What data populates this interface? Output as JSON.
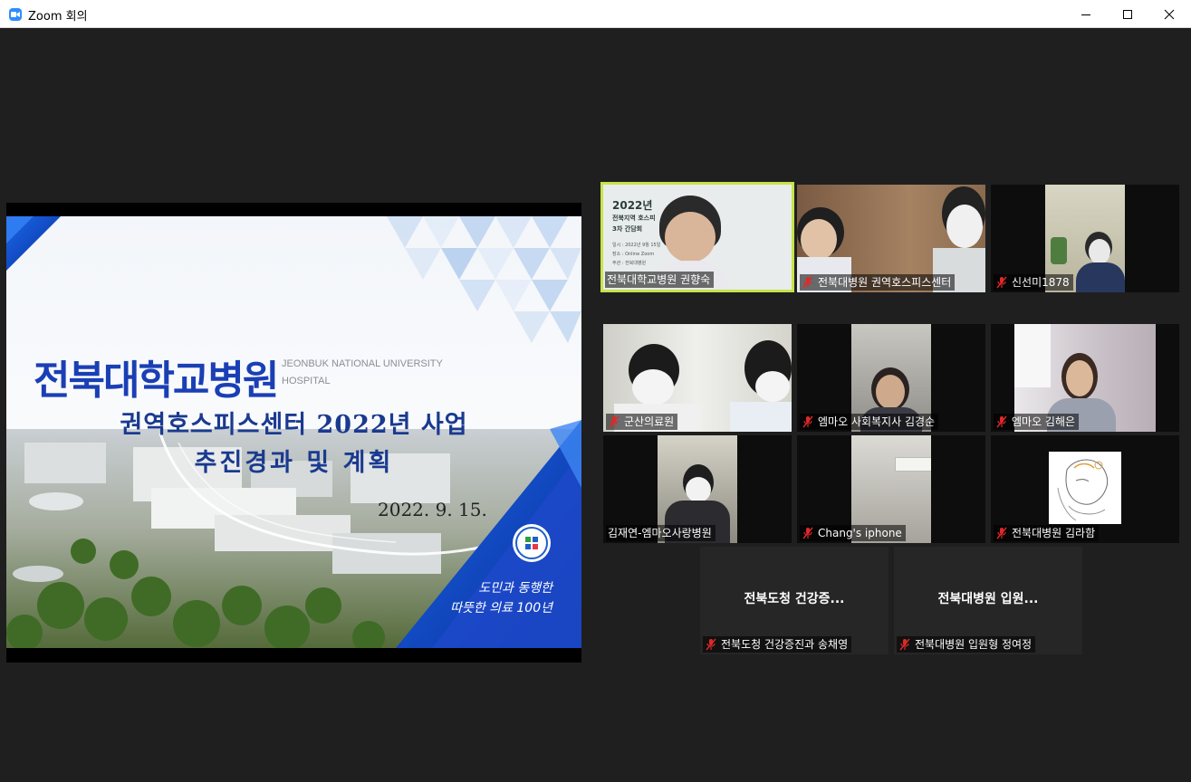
{
  "window": {
    "title": "Zoom 회의"
  },
  "colors": {
    "active_speaker": "#c7e34a",
    "background": "#1f1f1f",
    "mute": "#e02828"
  },
  "share": {
    "hospital_name_ko": "전북대학교병원",
    "hospital_name_en_1": "JEONBUK NATIONAL UNIVERSITY",
    "hospital_name_en_2": "HOSPITAL",
    "title_line1": "권역호스피스센터 2022년 사업",
    "title_line2": "추진경과 및 계획",
    "date": "2022. 9. 15.",
    "slogan_line1": "도민과 동행한",
    "slogan_line2": "따뜻한 의료 100년"
  },
  "thumb": {
    "line1": "2022년",
    "line2": "전북지역 호스피",
    "line3": "3차 간담회",
    "line4": "일시 : 2022년 9월 15일",
    "line5": "장소 : Online Zoom",
    "line6": "주관 : 전북대병원"
  },
  "participants": [
    {
      "name": "전북대학교병원 권향숙",
      "muted": false
    },
    {
      "name": "전북대병원 권역호스피스센터",
      "muted": true
    },
    {
      "name": "신선미1878",
      "muted": true
    },
    {
      "name": "군산의료원",
      "muted": true
    },
    {
      "name": "엠마오 사회복지사 김경순",
      "muted": true
    },
    {
      "name": "엠마오 김해은",
      "muted": true
    },
    {
      "name": "김재연-엠마오사랑병원",
      "muted": false
    },
    {
      "name": "Chang's iphone",
      "muted": true
    },
    {
      "name": "전북대병원 김라함",
      "muted": true
    },
    {
      "name": "전북도청 건강증진과 송채영",
      "muted": true,
      "display": "전북도청 건강증..."
    },
    {
      "name": "전북대병원 입원형 정여정",
      "muted": true,
      "display": "전북대병원 입원..."
    }
  ]
}
